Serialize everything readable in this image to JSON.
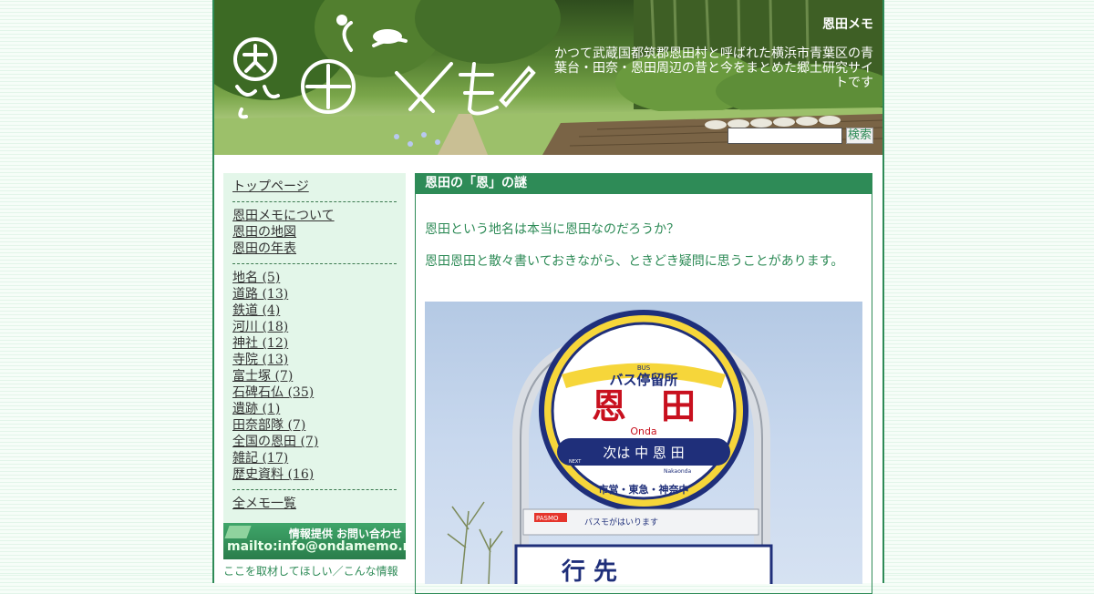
{
  "header": {
    "site_title": "恩田メモ",
    "description": "かつて武蔵国都筑郡恩田村と呼ばれた横浜市青葉区の青葉台・田奈・恩田周辺の昔と今をまとめた郷土研究サイトです",
    "logo_text": "恩田メモ",
    "search": {
      "placeholder": "",
      "button_label": "検索"
    }
  },
  "sidebar": {
    "groups": [
      {
        "items": [
          {
            "label": "トップページ"
          }
        ]
      },
      {
        "items": [
          {
            "label": "恩田メモについて"
          },
          {
            "label": "恩田の地図"
          },
          {
            "label": "恩田の年表"
          }
        ]
      },
      {
        "items": [
          {
            "label": "地名 (5)"
          },
          {
            "label": "道路 (13)"
          },
          {
            "label": "鉄道 (4)"
          },
          {
            "label": "河川 (18)"
          },
          {
            "label": "神社 (12)"
          },
          {
            "label": "寺院 (13)"
          },
          {
            "label": "富士塚 (7)"
          },
          {
            "label": "石碑石仏 (35)"
          },
          {
            "label": "遺跡 (1)"
          },
          {
            "label": "田奈部隊 (7)"
          },
          {
            "label": "全国の恩田 (7)"
          },
          {
            "label": "雑記 (17)"
          },
          {
            "label": "歴史資料 (16)"
          }
        ]
      },
      {
        "items": [
          {
            "label": "全メモ一覧"
          }
        ]
      }
    ],
    "contact": {
      "banner_line1": "情報提供 お問い合わせ",
      "banner_line2": "mailto:info@ondamemo.net",
      "note": "ここを取材してほしい／こんな情報"
    }
  },
  "article": {
    "title": "恩田の「恩」の謎",
    "paragraphs": [
      "恩田という地名は本当に恩田なのだろうか？",
      "恩田恩田と散々書いておきながら、ときどき疑問に思うことがあります。"
    ],
    "photo": {
      "sign_header": "バス停留所",
      "sign_bus": "BUS",
      "sign_main": "恩　田",
      "sign_romaji": "Onda",
      "sign_next": "次は 中 恩 田",
      "sign_next_label": "NEXT",
      "sign_next_romaji": "Nakaonda",
      "sign_operators": "市営・東急・神奈中",
      "panel_text": "バスモがはいります",
      "panel_brand": "PASMO",
      "board_text": "行 先"
    }
  }
}
